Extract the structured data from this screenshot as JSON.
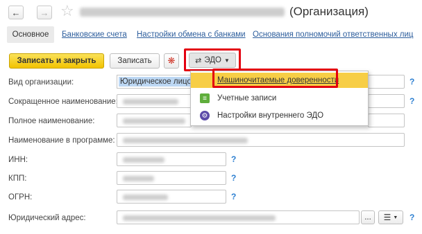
{
  "window": {
    "title": "(Организация)",
    "back_icon": "arrow-left",
    "forward_icon": "arrow-right",
    "favorite_icon": "star"
  },
  "tabs": {
    "active": "Основное",
    "links": [
      "Банковские счета",
      "Настройки обмена с банками",
      "Основания полномочий ответственных лиц"
    ]
  },
  "toolbar": {
    "save_close": "Записать и закрыть",
    "save": "Записать",
    "edo": "ЭДО"
  },
  "edo_menu": {
    "items": [
      {
        "label": "Машиночитаемые доверенности",
        "icon": "none",
        "selected": true
      },
      {
        "label": "Учетные записи",
        "icon": "accounts-icon",
        "selected": false
      },
      {
        "label": "Настройки внутреннего ЭДО",
        "icon": "settings-edo-icon",
        "selected": false
      }
    ]
  },
  "form": {
    "org_type_label": "Вид организации:",
    "org_type_value": "Юридическое лицо",
    "short_name_label": "Сокращенное наименование:",
    "full_name_label": "Полное наименование:",
    "program_name_label": "Наименование в программе:",
    "inn_label": "ИНН:",
    "kpp_label": "КПП:",
    "ogrn_label": "ОГРН:",
    "address_label": "Юридический адрес:",
    "help_mark": "?",
    "ellipsis": "..."
  },
  "colors": {
    "accent_yellow": "#f2c300",
    "highlight_red": "#e3000f",
    "link_blue": "#2c5d9c",
    "menu_selected": "#f7ce46"
  }
}
